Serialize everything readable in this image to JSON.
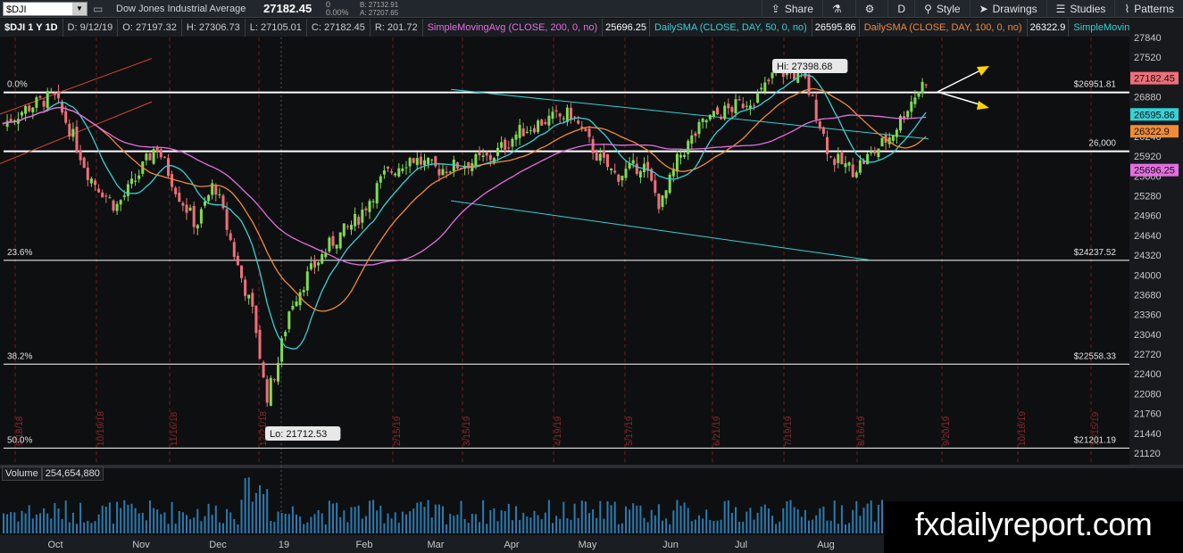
{
  "toolbar": {
    "symbol": "$DJI",
    "name": "Dow Jones Industrial Average",
    "last": "27182.45",
    "change": "0",
    "change_pct": "0.00%",
    "bid": "B: 27132.91",
    "ask": "A: 27207.65",
    "buttons": {
      "share": "Share",
      "period": "D",
      "style": "Style",
      "drawings": "Drawings",
      "studies": "Studies",
      "patterns": "Patterns"
    }
  },
  "info": {
    "symbol": "$DJI 1 Y 1D",
    "date": "D: 9/12/19",
    "open": "O: 27197.32",
    "high": "H: 27306.73",
    "low": "L: 27105.01",
    "close": "C: 27182.45",
    "range": "R: 201.72",
    "sma200": "SimpleMovingAvg (CLOSE, 200, 0, no)",
    "sma200_val": "25696.25",
    "sma50": "DailySMA (CLOSE, DAY, 50, 0, no)",
    "sma50_val": "26595.86",
    "sma100": "DailySMA (CLOSE, DAY, 100, 0, no)",
    "sma100_val": "26322.9",
    "more": "SimpleMoving..."
  },
  "volume": {
    "label": "Volume",
    "value": "254,654,880"
  },
  "watermark": "fxdailyreport.com",
  "colors": {
    "up": "#7fdc52",
    "down": "#ef6f7a",
    "sma50": "#34d2d6",
    "sma100": "#f08b37",
    "sma200": "#e46fe0",
    "trend_red": "#e0452f",
    "trend_cyan": "#34d2d6",
    "fib": "#ffffff",
    "arrow": "#ffd400"
  },
  "chart_data": {
    "type": "candlestick",
    "y_ticks": [
      27840,
      27520,
      27200,
      26880,
      26560,
      26240,
      25920,
      25600,
      25280,
      24960,
      24640,
      24320,
      24000,
      23680,
      23360,
      23040,
      22720,
      22400,
      22080,
      21760,
      21440,
      21120
    ],
    "y_range": [
      21000,
      28000
    ],
    "x_month_labels": [
      "Oct",
      "Nov",
      "Dec",
      "19",
      "Feb",
      "Mar",
      "Apr",
      "May",
      "Jun",
      "Jul",
      "Aug"
    ],
    "date_markers": [
      "9/18/18",
      "10/19/18",
      "11/16/18",
      "12/21/18",
      "2/15/19",
      "3/15/19",
      "4/19/19",
      "5/17/19",
      "6/21/19",
      "7/19/19",
      "8/16/19",
      "9/20/19",
      "10/18/19",
      "11/15/19"
    ],
    "fib_levels": [
      {
        "name": "0.0%",
        "value": 26951.81,
        "label": "$26951.81"
      },
      {
        "name": "",
        "value": 26000,
        "label": "26,000"
      },
      {
        "name": "23.6%",
        "value": 24237.52,
        "label": "$24237.52"
      },
      {
        "name": "38.2%",
        "value": 22558.33,
        "label": "$22558.33"
      },
      {
        "name": "50.0%",
        "value": 21201.19,
        "label": "$21201.19"
      }
    ],
    "price_tags": [
      {
        "label": "27182.45",
        "value": 27182.45,
        "color": "#ef6f7a"
      },
      {
        "label": "26595.86",
        "value": 26595.86,
        "color": "#34d2d6"
      },
      {
        "label": "26322.9",
        "value": 26322.9,
        "color": "#f08b37"
      },
      {
        "label": "25696.25",
        "value": 25696.25,
        "color": "#e46fe0"
      }
    ],
    "annotations": {
      "high": "Hi: 27398.68",
      "low": "Lo: 21712.53"
    }
  }
}
